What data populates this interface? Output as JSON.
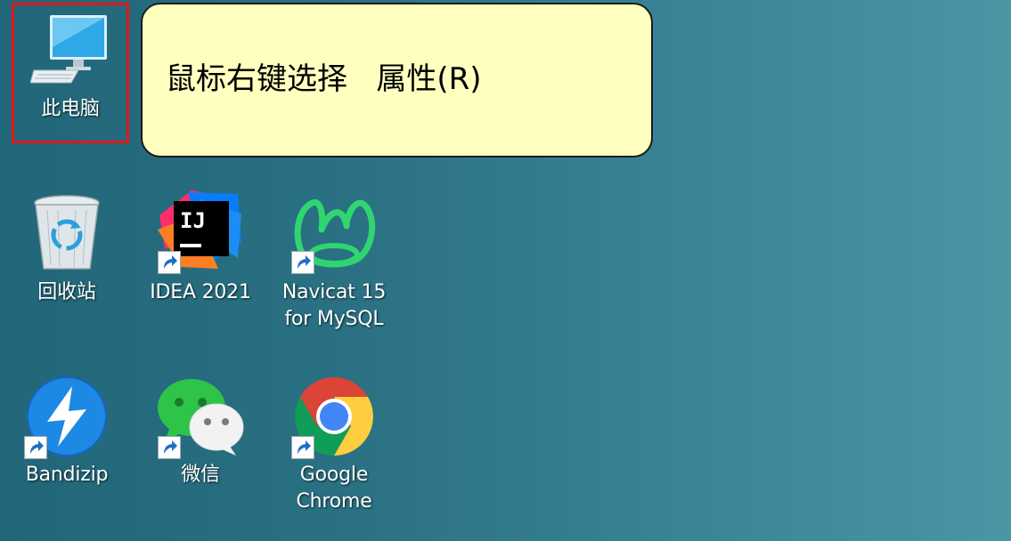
{
  "callout": {
    "text": "鼠标右键选择   属性(R)"
  },
  "icons": [
    {
      "label": "此电脑"
    },
    {
      "label": "回收站"
    },
    {
      "label": "IDEA 2021"
    },
    {
      "label": "Navicat 15\nfor MySQL"
    },
    {
      "label": "Bandizip"
    },
    {
      "label": "微信"
    },
    {
      "label": "Google\nChrome"
    }
  ],
  "colors": {
    "highlight": "#e01818",
    "callout_bg": "#ffffc0",
    "desktop_left": "#216679",
    "desktop_right": "#4a96a5"
  }
}
